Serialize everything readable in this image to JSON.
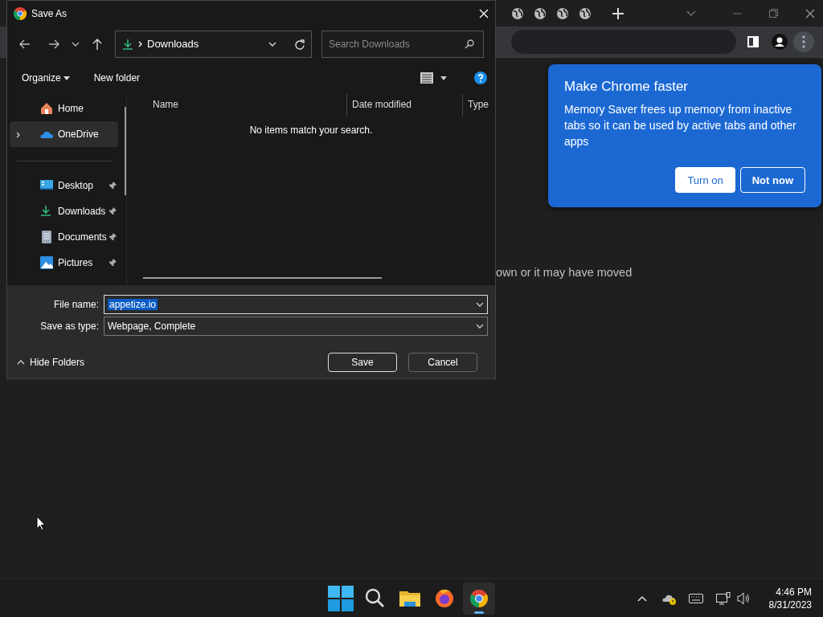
{
  "browser": {
    "page_message": "own or it may have moved",
    "bubble": {
      "title": "Make Chrome faster",
      "body": "Memory Saver frees up memory from inactive tabs so it can be used by active tabs and other apps",
      "buttons": [
        {
          "label": "Turn on",
          "kind": "primary"
        },
        {
          "label": "Not now",
          "kind": "secondary"
        }
      ]
    }
  },
  "dialog": {
    "title": "Save As",
    "location": "Downloads",
    "search": {
      "placeholder": "Search Downloads"
    },
    "commands": [
      "Organize",
      "New folder"
    ],
    "sidebar": {
      "top": [
        {
          "label": "Home",
          "kind": "home",
          "selected": false,
          "expandable": false
        },
        {
          "label": "OneDrive",
          "kind": "onedrive",
          "selected": true,
          "expandable": true
        }
      ],
      "quick_access": [
        {
          "label": "Desktop",
          "kind": "desktop",
          "pinned": true
        },
        {
          "label": "Downloads",
          "kind": "downloads",
          "pinned": true
        },
        {
          "label": "Documents",
          "kind": "documents",
          "pinned": true
        },
        {
          "label": "Pictures",
          "kind": "pictures",
          "pinned": true
        }
      ]
    },
    "columns": [
      "Name",
      "Date modified",
      "Type"
    ],
    "empty_message": "No items match your search.",
    "file_name": {
      "label": "File name:",
      "value": "appetize.io",
      "text_selected": true
    },
    "save_type": {
      "label": "Save as type:",
      "value": "Webpage, Complete"
    },
    "hide_folders": "Hide Folders",
    "buttons": [
      {
        "label": "Save",
        "default": true
      },
      {
        "label": "Cancel",
        "default": false
      }
    ]
  },
  "taskbar": {
    "apps": [
      {
        "kind": "start",
        "active": false
      },
      {
        "kind": "search",
        "active": false
      },
      {
        "kind": "explorer",
        "active": false
      },
      {
        "kind": "firefox",
        "active": false
      },
      {
        "kind": "chrome",
        "active": true
      }
    ],
    "time": "4:46 PM",
    "date": "8/31/2023"
  }
}
